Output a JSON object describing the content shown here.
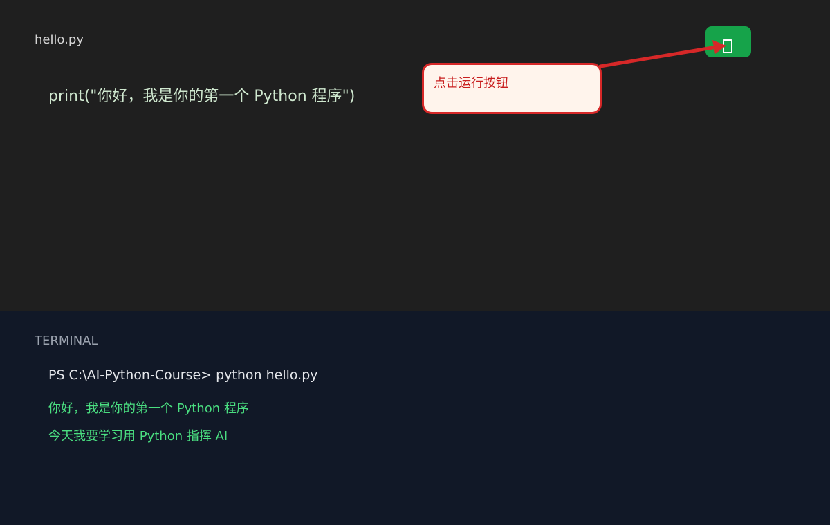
{
  "editor": {
    "file_tab": "hello.py",
    "code": "print(\"你好，我是你的第一个 Python 程序\")",
    "run_button_icon": "run-icon",
    "run_button_color": "#16a34a"
  },
  "annotation": {
    "text": "点击运行按钮",
    "color": "#d62828"
  },
  "terminal": {
    "title": "TERMINAL",
    "command": "PS C:\\AI-Python-Course> python hello.py",
    "output": [
      "你好，我是你的第一个 Python 程序",
      "今天我要学习用 Python 指挥 AI"
    ],
    "output_color": "#4ade80"
  }
}
